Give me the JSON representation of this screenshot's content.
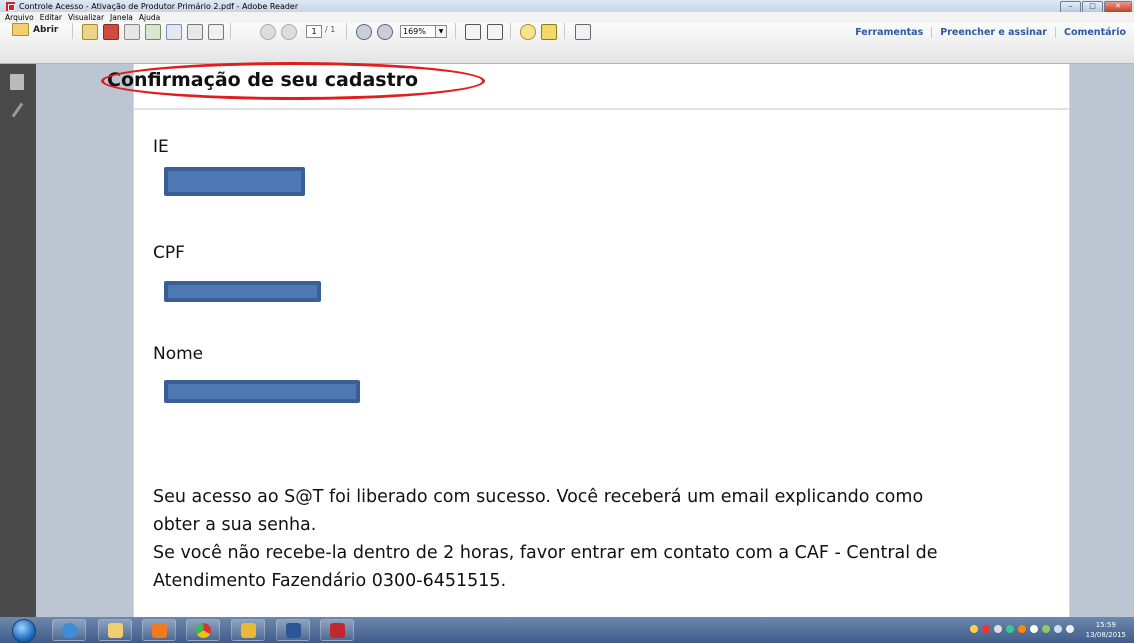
{
  "window": {
    "title": "Controle Acesso - Ativação de Produtor Primário 2.pdf - Adobe Reader"
  },
  "menu": [
    "Arquivo",
    "Editar",
    "Visualizar",
    "Janela",
    "Ajuda"
  ],
  "toolbar": {
    "open_label": "Abrir",
    "page_current": "1",
    "page_total": "/ 1",
    "zoom": "169%",
    "right_links": [
      "Ferramentas",
      "Preencher e assinar",
      "Comentário"
    ]
  },
  "document": {
    "title": "Confirmação de seu cadastro",
    "fields": [
      {
        "label": "IE"
      },
      {
        "label": "CPF"
      },
      {
        "label": "Nome"
      }
    ],
    "message_lines": [
      "Seu acesso ao S@T foi liberado com sucesso. Você receberá um email explicando como",
      "obter a sua senha.",
      "Se você não recebe-la dentro de 2 horas, favor entrar em contato com a CAF - Central de",
      "Atendimento Fazendário 0300-6451515."
    ]
  },
  "taskbar": {
    "clock_time": "15:59",
    "clock_date": "13/08/2015"
  },
  "colors": {
    "annotation_red": "#e11d1d",
    "redaction_blue": "#4d78b3",
    "link_blue": "#2c5aa0"
  }
}
